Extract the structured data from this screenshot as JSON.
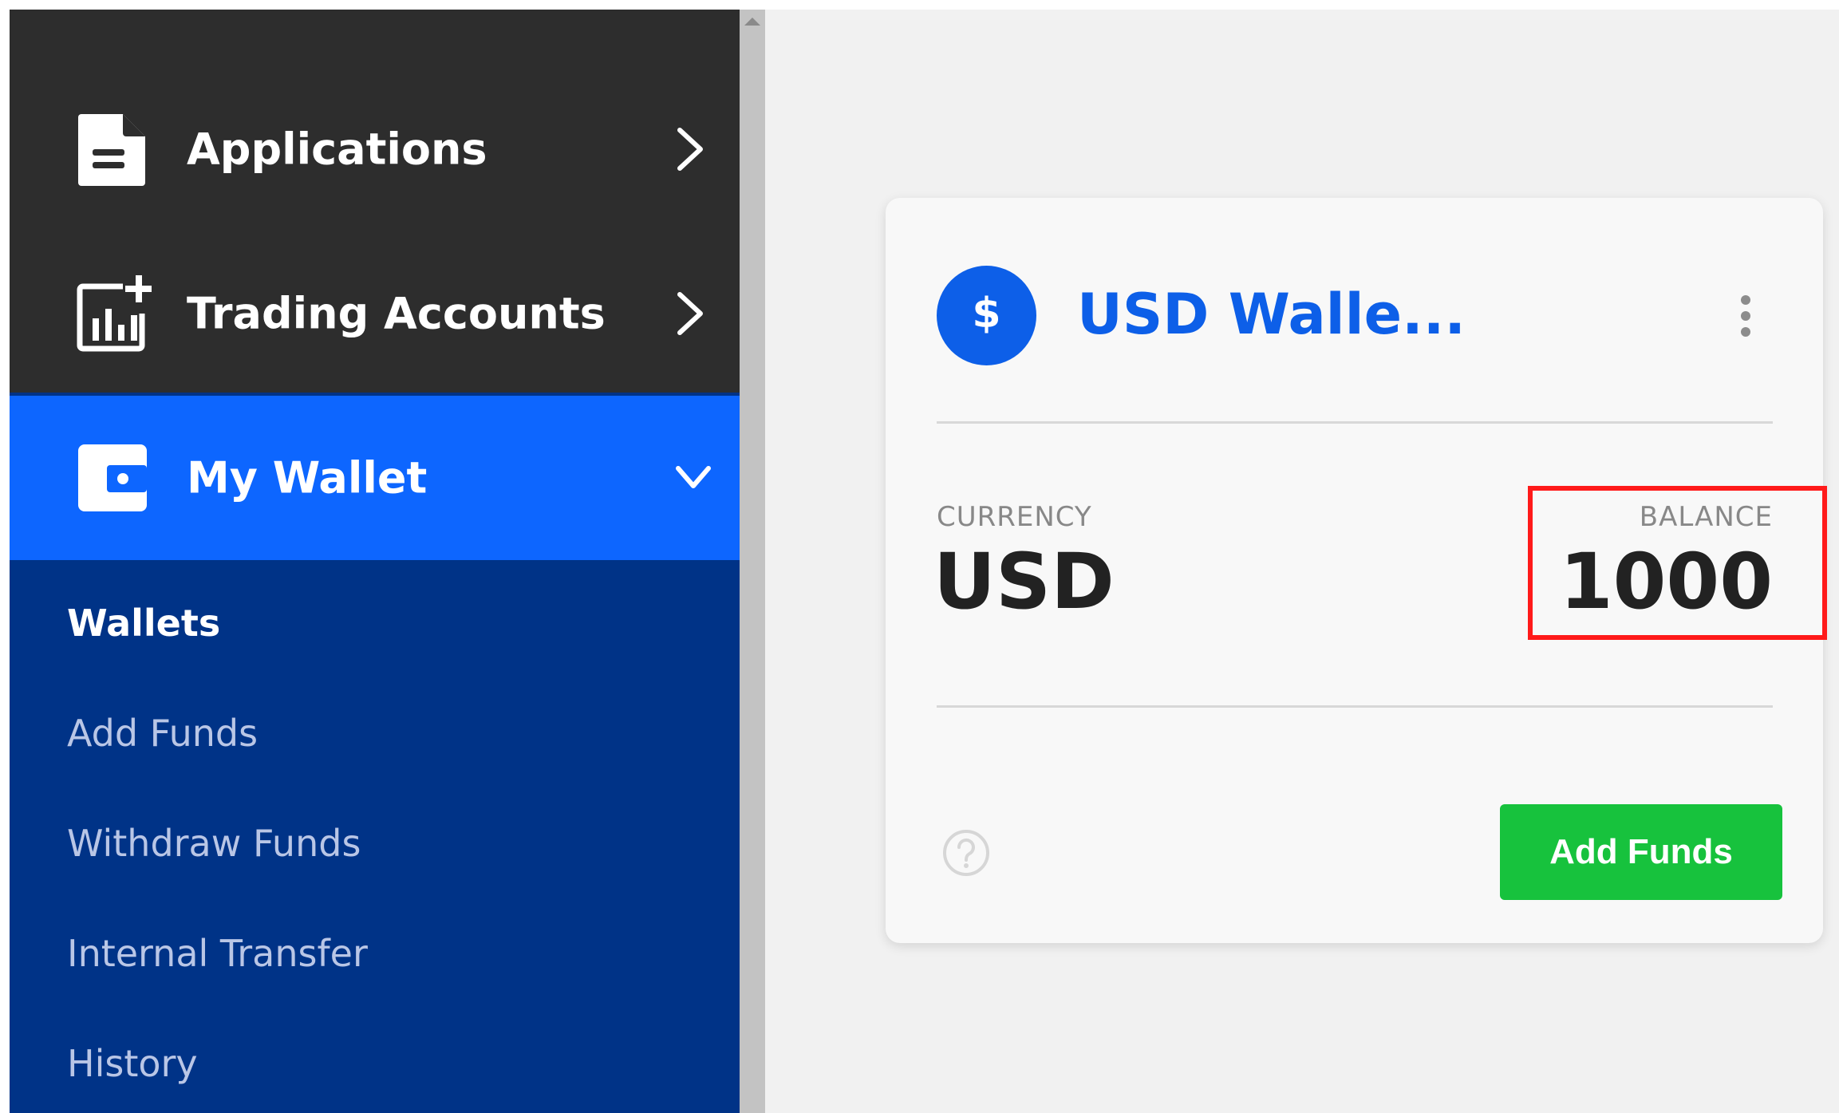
{
  "sidebar": {
    "items": [
      {
        "label": "Applications",
        "icon": "document-icon"
      },
      {
        "label": "Trading Accounts",
        "icon": "chart-add-icon"
      },
      {
        "label": "My Wallet",
        "icon": "wallet-icon"
      }
    ],
    "sub_items": [
      {
        "label": "Wallets"
      },
      {
        "label": "Add Funds"
      },
      {
        "label": "Withdraw Funds"
      },
      {
        "label": "Internal Transfer"
      },
      {
        "label": "History"
      }
    ]
  },
  "wallet_card": {
    "coin_symbol": "$",
    "title": "USD Walle...",
    "currency_label": "CURRENCY",
    "currency_value": "USD",
    "balance_label": "BALANCE",
    "balance_value": "1000",
    "add_funds_label": "Add Funds"
  },
  "colors": {
    "sidebar_dark": "#2d2d2d",
    "sidebar_active": "#0d66ff",
    "sidebar_submenu": "#003387",
    "brand_blue": "#0d5fe8",
    "button_green": "#17c23d",
    "highlight_red": "#ff1a1a"
  }
}
